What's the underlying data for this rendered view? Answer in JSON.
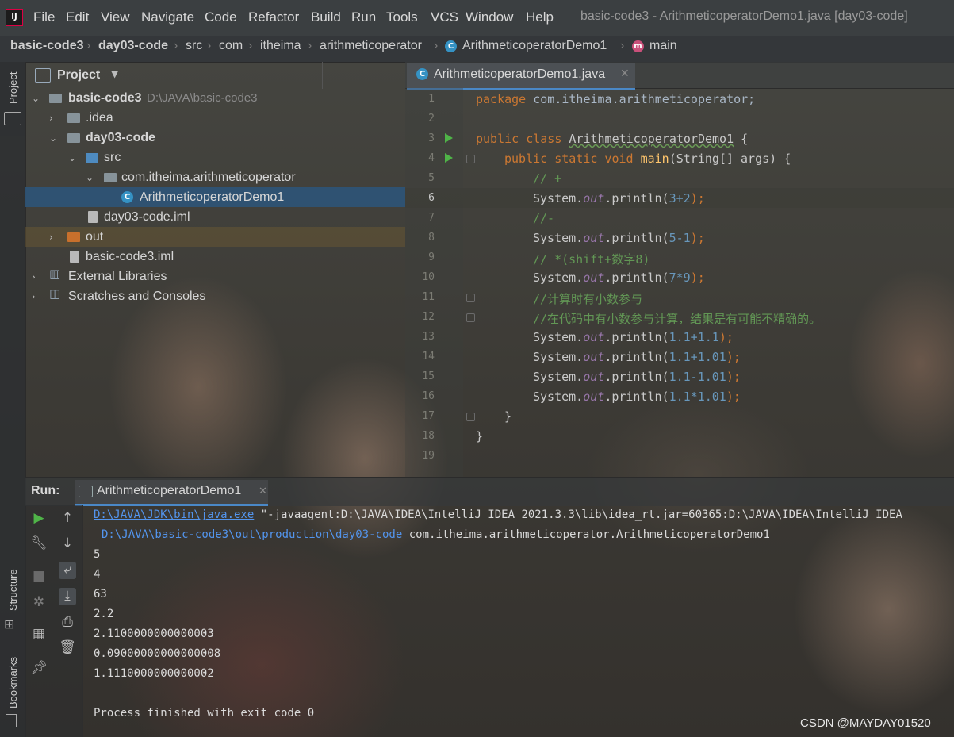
{
  "menu": {
    "items": [
      "File",
      "Edit",
      "View",
      "Navigate",
      "Code",
      "Refactor",
      "Build",
      "Run",
      "Tools",
      "VCS",
      "Window",
      "Help"
    ],
    "window_title": "basic-code3 - ArithmeticoperatorDemo1.java [day03-code]"
  },
  "breadcrumb": [
    "basic-code3",
    "day03-code",
    "src",
    "com",
    "itheima",
    "arithmeticoperator",
    "ArithmeticoperatorDemo1",
    "main"
  ],
  "side_tabs": {
    "project": "Project",
    "structure": "Structure",
    "bookmarks": "Bookmarks"
  },
  "project": {
    "title": "Project",
    "tree": [
      {
        "label": "basic-code3",
        "hint": "D:\\JAVA\\basic-code3"
      },
      {
        "label": ".idea"
      },
      {
        "label": "day03-code"
      },
      {
        "label": "src"
      },
      {
        "label": "com.itheima.arithmeticoperator"
      },
      {
        "label": "ArithmeticoperatorDemo1",
        "selected": true
      },
      {
        "label": "day03-code.iml"
      },
      {
        "label": "out"
      },
      {
        "label": "basic-code3.iml"
      },
      {
        "label": "External Libraries"
      },
      {
        "label": "Scratches and Consoles"
      }
    ]
  },
  "editor": {
    "tab": "ArithmeticoperatorDemo1.java",
    "line_numbers": [
      "1",
      "2",
      "3",
      "4",
      "5",
      "6",
      "7",
      "8",
      "9",
      "10",
      "11",
      "12",
      "13",
      "14",
      "15",
      "16",
      "17",
      "18",
      "19"
    ],
    "current_line": "6",
    "code": {
      "l1_kw": "package",
      "l1_rest": " com.itheima.arithmeticoperator;",
      "l3_kw": "public class ",
      "l3_cls": "ArithmeticoperatorDemo1",
      "l3_rest": " {",
      "l4_kw": "public static void ",
      "l4_fn": "main",
      "l4_rest": "(String[] args) {",
      "l5": "// +",
      "l6_a": "System.",
      "l6_b": "out",
      "l6_c": ".println(",
      "l6_n": "3+2",
      "l6_d": ");",
      "l7": "//-",
      "l8_n": "5-1",
      "l9": "// *(shift+数字8)",
      "l10_n": "7*9",
      "l11": "//计算时有小数参与",
      "l12": "//在代码中有小数参与计算，结果是有可能不精确的。",
      "l13_n": "1.1+1.1",
      "l14_n": "1.1+1.01",
      "l15_n": "1.1-1.01",
      "l16_n": "1.1*1.01",
      "l17": "}",
      "l18": "}"
    }
  },
  "run": {
    "label": "Run:",
    "tab": "ArithmeticoperatorDemo1",
    "cmd1_link": "D:\\JAVA\\JDK\\bin\\java.exe",
    "cmd1_rest": " \"-javaagent:D:\\JAVA\\IDEA\\IntelliJ IDEA 2021.3.3\\lib\\idea_rt.jar=60365:D:\\JAVA\\IDEA\\IntelliJ IDEA",
    "cmd2_link": "D:\\JAVA\\basic-code3\\out\\production\\day03-code",
    "cmd2_rest": " com.itheima.arithmeticoperator.ArithmeticoperatorDemo1",
    "output": [
      "5",
      "4",
      "63",
      "2.2",
      "2.1100000000000003",
      "0.09000000000000008",
      "1.1110000000000002"
    ],
    "exit": "Process finished with exit code 0"
  },
  "watermark": "CSDN @MAYDAY01520"
}
